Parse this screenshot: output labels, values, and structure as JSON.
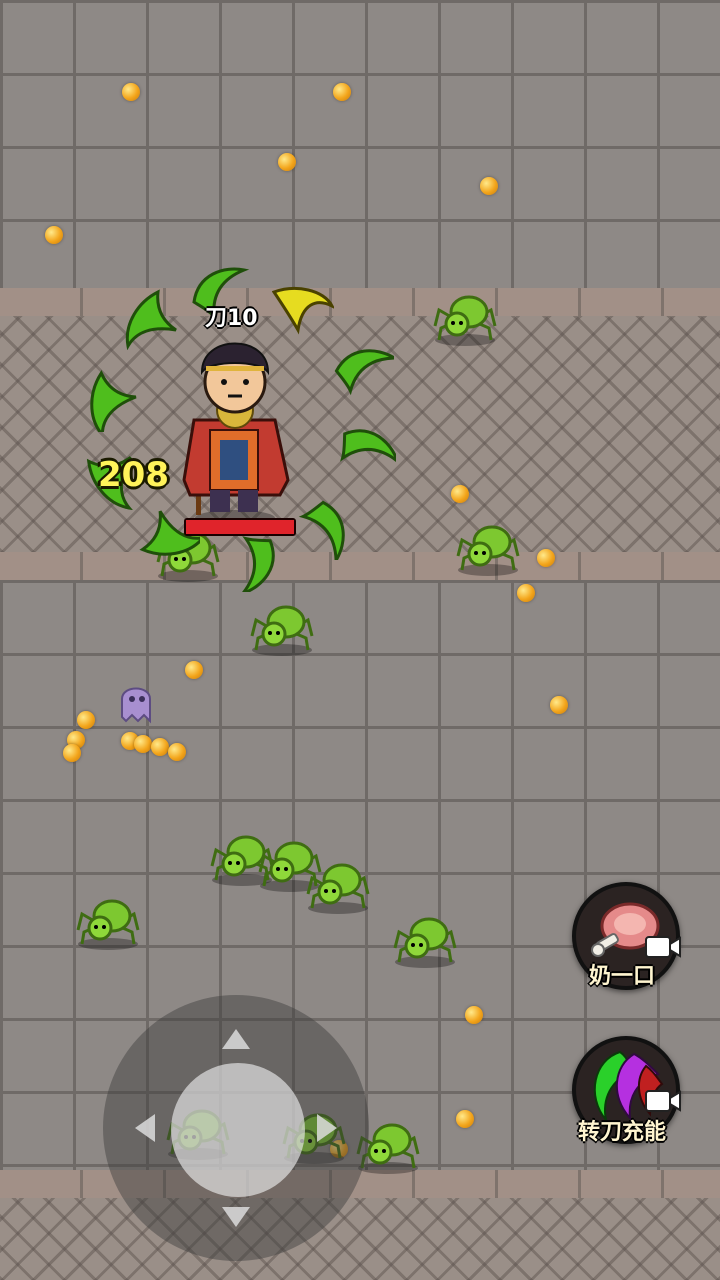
{
  "hud": {
    "weapon_tag": "刀10",
    "damage_number": "208",
    "player_hp_fraction": 1.0
  },
  "skills": [
    {
      "label": "奶一口",
      "icon": "meat-icon",
      "has_video_ad": true
    },
    {
      "label": "转刀充能",
      "icon": "spinning-blades-icon",
      "has_video_ad": true
    }
  ],
  "controls": {
    "joystick": "virtual-joystick",
    "arrows": [
      "up",
      "down",
      "left",
      "right"
    ]
  },
  "colors": {
    "blade": "#4fbe1d",
    "blade_highlight": "#e6dc20",
    "hp": "#e0242b",
    "coin": "#f3a51b",
    "enemy": "#7dc830"
  }
}
